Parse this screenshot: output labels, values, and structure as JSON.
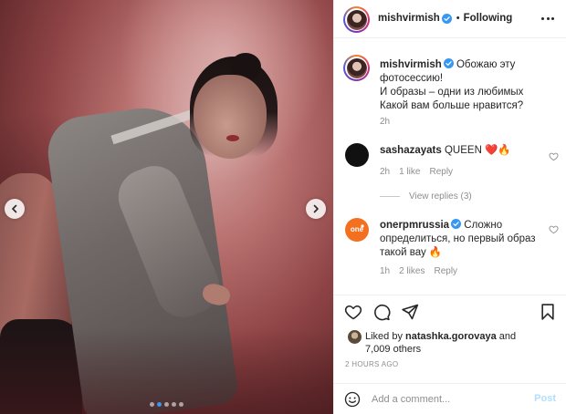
{
  "post": {
    "author": "mishvirmish",
    "follow_status": "Following",
    "separator": "•",
    "carousel": {
      "slide_count": 5,
      "active_index": 1
    }
  },
  "caption": {
    "username": "mishvirmish",
    "lines": [
      "Обожаю эту фотосессию!",
      "И образы – одни из любимых",
      "Какой вам больше нравится?"
    ],
    "time": "2h"
  },
  "comments": [
    {
      "username": "sashazayats",
      "text": "QUEEN ❤️🔥",
      "time": "2h",
      "likes": "1 like",
      "reply_label": "Reply",
      "view_replies": "View replies (3)"
    },
    {
      "username": "onerpmrussia",
      "text": "Сложно определиться, но первый образ такой вау 🔥",
      "time": "1h",
      "likes": "2 likes",
      "reply_label": "Reply"
    }
  ],
  "likes": {
    "prefix": "Liked by",
    "user": "natashka.gorovaya",
    "connector": "and",
    "others": "7,009 others"
  },
  "timestamp": "2 hours ago",
  "comment_box": {
    "placeholder": "Add a comment...",
    "post_label": "Post"
  },
  "colors": {
    "verified": "#3897f0",
    "post_disabled": "#b2dffc",
    "onerpm_orange": "#f37021"
  }
}
